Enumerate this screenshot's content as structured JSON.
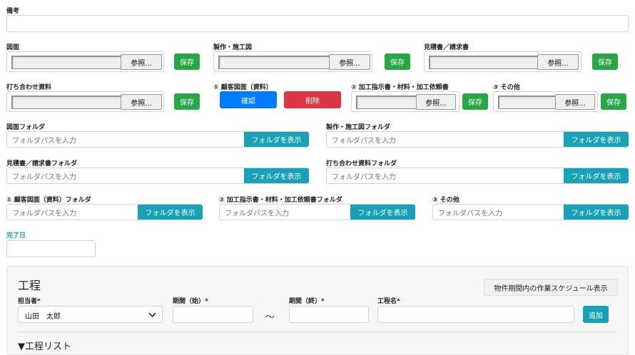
{
  "remarks": {
    "label": "備考"
  },
  "file_rows": [
    {
      "label": "図面",
      "browse": "参照...",
      "save": "保存"
    },
    {
      "label": "製作・施工図",
      "browse": "参照...",
      "save": "保存"
    },
    {
      "label": "見積書／請求書",
      "browse": "参照...",
      "save": "保存"
    },
    {
      "label": "打ち合わせ資料",
      "browse": "参照...",
      "save": "保存"
    },
    {
      "label": "② 加工指示書・材料・加工依頼書",
      "browse": "参照...",
      "save": "保存"
    },
    {
      "label": "③ その他",
      "browse": "参照...",
      "save": "保存"
    }
  ],
  "customer_drawing": {
    "label": "① 顧客図面（資料）",
    "confirm": "確認",
    "delete": "削除"
  },
  "folders": {
    "placeholder": "フォルダパスを入力",
    "button": "フォルダを表示",
    "items": [
      {
        "label": "図面フォルダ"
      },
      {
        "label": "製作・施工図フォルダ"
      },
      {
        "label": "見積書／請求書フォルダ"
      },
      {
        "label": "打ち合わせ資料フォルダ"
      },
      {
        "label": "① 顧客図面（資料）フォルダ"
      },
      {
        "label": "② 加工指示書・材料・加工依頼書フォルダ"
      },
      {
        "label": "③ その他"
      }
    ]
  },
  "completion": {
    "label": "完了日"
  },
  "process": {
    "title": "工程",
    "schedule_button": "物件期間内の作業スケジュール表示",
    "assignee_label": "担当者*",
    "assignee_value": "山田　太郎",
    "start_label": "期間（始）*",
    "end_label": "期間（終）*",
    "tilde": "～",
    "name_label": "工程名*",
    "add_button": "追加",
    "list_toggle": "▼工程リスト"
  },
  "colors": {
    "save": "#28a745",
    "confirm": "#007bff",
    "delete": "#dc3545",
    "folder": "#17a2b8"
  }
}
